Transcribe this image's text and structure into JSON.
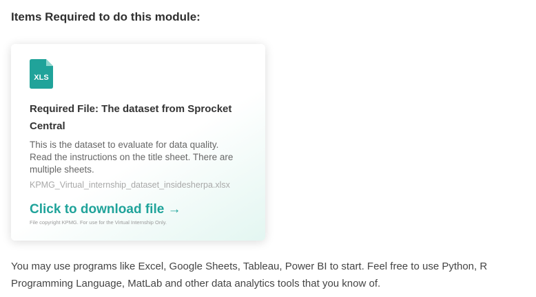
{
  "module": {
    "heading": "Items Required to do this module:"
  },
  "file_card": {
    "icon_label": "XLS",
    "icon_color": "#20a39a",
    "title": "Required File: The dataset from Sprocket Central",
    "description": "This is the dataset to evaluate for data quality. Read the instructions on the title sheet. There are multiple sheets.",
    "file_name": "KPMG_Virtual_internship_dataset_insidesherpa.xlsx",
    "download_label": "Click to download file →",
    "download_color": "#1fa39a",
    "copyright": "File copyright KPMG. For use for the Virtual Internship Only."
  },
  "body": {
    "text": "You may use programs like Excel, Google Sheets, Tableau, Power BI to start. Feel free to use Python, R Programming Language, MatLab and other data analytics tools that you know of."
  }
}
